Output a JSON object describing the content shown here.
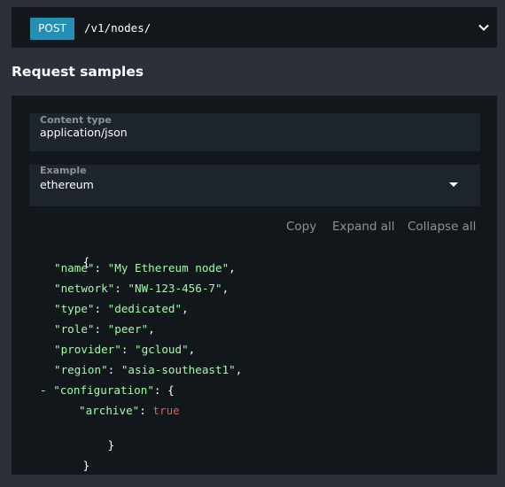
{
  "endpoint": {
    "method": "POST",
    "path": "/v1/nodes/"
  },
  "section": {
    "title": "Request samples"
  },
  "content_type": {
    "label": "Content type",
    "value": "application/json"
  },
  "example": {
    "label": "Example",
    "selected": "ethereum"
  },
  "actions": {
    "copy": "Copy",
    "expand_all": "Expand all",
    "collapse_all": "Collapse all"
  },
  "code": {
    "open_brace": "{",
    "close_brace": "}",
    "fields": [
      {
        "key": "\"name\"",
        "value": "\"My Ethereum node\""
      },
      {
        "key": "\"network\"",
        "value": "\"NW-123-456-7\""
      },
      {
        "key": "\"type\"",
        "value": "\"dedicated\""
      },
      {
        "key": "\"role\"",
        "value": "\"peer\""
      },
      {
        "key": "\"provider\"",
        "value": "\"gcloud\""
      },
      {
        "key": "\"region\"",
        "value": "\"asia-southeast1\""
      }
    ],
    "nested": {
      "collapser": "-",
      "key": "\"configuration\"",
      "open_brace": "{",
      "close_brace": "}",
      "child_key": "\"archive\"",
      "child_value": "true"
    }
  },
  "colors": {
    "background": "#2b3039",
    "panel": "#11171a",
    "method_badge": "#248fb2",
    "json_string": "#a0fbaa",
    "json_boolean": "#ef5350",
    "muted_text": "#8d9299"
  },
  "icons": {
    "endpoint_toggle": "chevron-down-icon",
    "example_dropdown": "caret-down-icon"
  }
}
